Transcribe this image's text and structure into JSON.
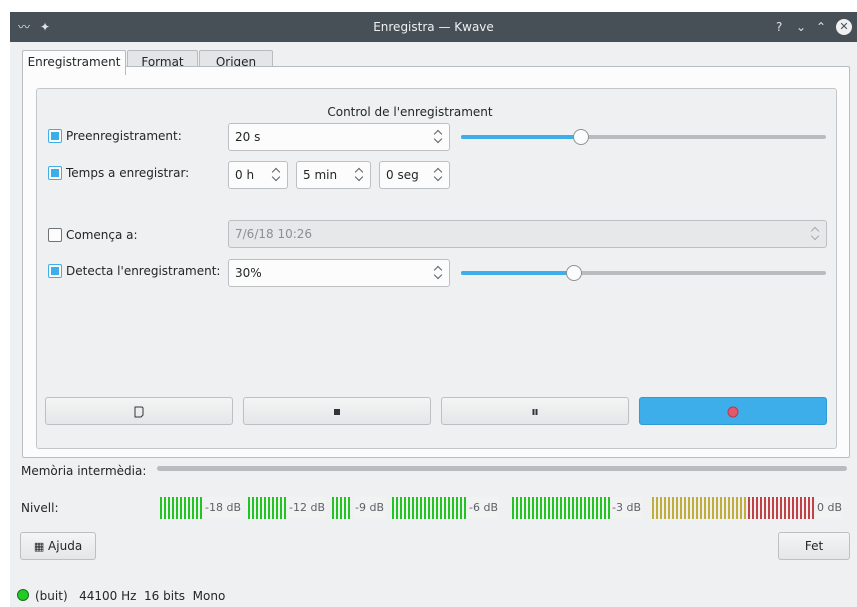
{
  "window": {
    "title": "Enregistra — Kwave",
    "controls": {
      "help": "?",
      "minimize": "⌄",
      "maximize": "⌃",
      "close": "✕"
    }
  },
  "tabs": [
    {
      "label": "Enregistrament",
      "active": true
    },
    {
      "label": "Format",
      "active": false
    },
    {
      "label": "Origen",
      "active": false
    }
  ],
  "recording": {
    "group_title": "Control de l'enregistrament",
    "prerecord": {
      "label": "Preenregistrament:",
      "checked": true,
      "value": "20 s",
      "slider_fraction": 0.33
    },
    "record_time": {
      "label": "Temps a enregistrar:",
      "checked": true,
      "hours": "0 h",
      "minutes": "5 min",
      "seconds": "0 seg"
    },
    "start_at": {
      "label": "Comença a:",
      "checked": false,
      "value": "7/6/18 10:26"
    },
    "trigger": {
      "label": "Detecta l'enregistrament:",
      "checked": true,
      "value": "30%",
      "slider_fraction": 0.31
    },
    "buttons": {
      "new": {
        "icon": "new-document-icon"
      },
      "stop": {
        "icon": "stop-icon"
      },
      "pause": {
        "icon": "pause-icon"
      },
      "record": {
        "icon": "record-icon"
      }
    }
  },
  "buffer": {
    "label": "Memòria intermèdia:",
    "fill_fraction": 0.0
  },
  "level": {
    "label": "Nivell:",
    "db_labels": [
      "-18 dB",
      "-12 dB",
      "-9 dB",
      "-6 dB",
      "-3 dB",
      "0 dB"
    ]
  },
  "footer": {
    "help_label": "Ajuda",
    "done_label": "Fet"
  },
  "status": {
    "state": "(buit)",
    "rate": "44100 Hz",
    "bits": "16 bits",
    "channels": "Mono"
  },
  "colors": {
    "accent": "#3daee9",
    "titlebar": "#475057",
    "meter_green": "#22c422",
    "meter_yellow": "#b8a21a",
    "meter_red": "#b8222a",
    "record_dot": "#e05a6c",
    "status_ok": "#22cc22"
  }
}
